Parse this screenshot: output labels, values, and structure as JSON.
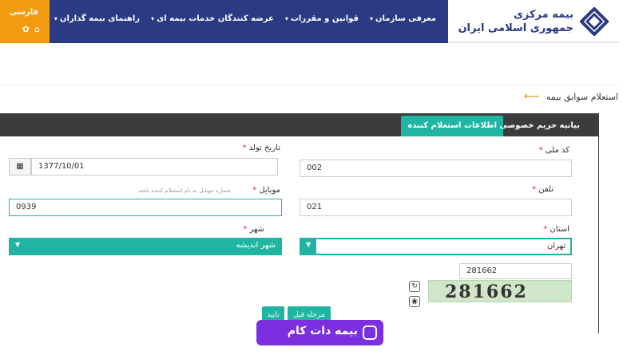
{
  "header": {
    "logo_line1": "بیمه مرکزی",
    "logo_line2": "جمهوری اسلامی ایران",
    "nav": [
      "معرفی سازمان",
      "قوانین و مقررات",
      "عرضه کنندگان خدمات بیمه ای",
      "راهنمای بیمه گذاران"
    ],
    "language": "فارسی"
  },
  "breadcrumb": {
    "title": "استعلام سوابق بیمه"
  },
  "tabs": [
    {
      "label": "اطلاعات استعلام کننده",
      "active": true
    },
    {
      "label": "بیانیه حریم خصوصی",
      "active": false
    }
  ],
  "form": {
    "national_code": {
      "label": "کد ملی",
      "value": "002"
    },
    "birth_date": {
      "label": "تاریخ تولد",
      "value": "1377/10/01"
    },
    "phone": {
      "label": "تلفن",
      "value": "021"
    },
    "mobile": {
      "label": "موبایل",
      "hint": "شماره موبایل به نام استعلام کننده باشد",
      "value": "0939"
    },
    "province": {
      "label": "استان",
      "value": "تهران"
    },
    "city": {
      "label": "شهر",
      "value": "شهر اندیشه"
    },
    "captcha": {
      "value": "281662",
      "image_text": "281662"
    }
  },
  "buttons": {
    "prev": "مرحله قبل",
    "next": "تایید"
  },
  "watermark": {
    "text": "بیمه دات کام"
  },
  "colors": {
    "header": "#2b3a82",
    "teal": "#1fb5a2",
    "orange": "#f39c12",
    "brand": "#7b2fe0"
  }
}
